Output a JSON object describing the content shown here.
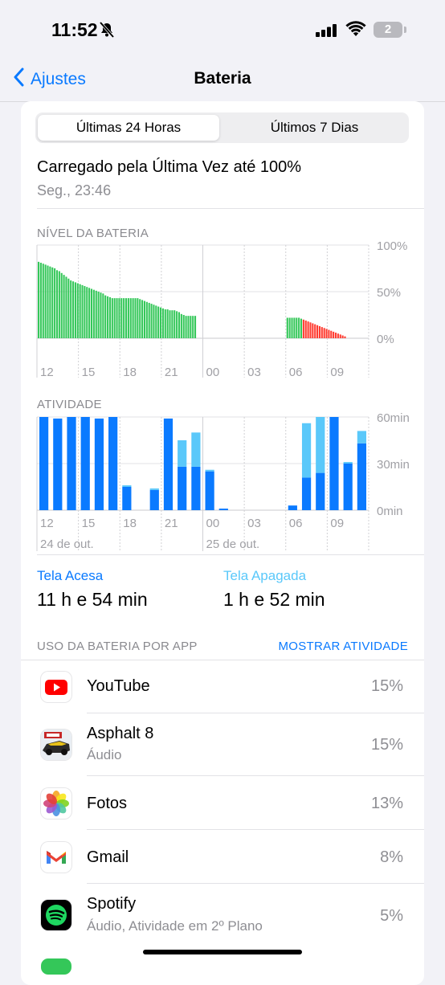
{
  "status_bar": {
    "time": "11:52",
    "battery": "2"
  },
  "nav": {
    "back_label": "Ajustes",
    "title": "Bateria"
  },
  "segments": [
    "Últimas 24 Horas",
    "Últimos 7 Dias"
  ],
  "last_charge": {
    "title": "Carregado pela Última Vez até 100%",
    "subtitle": "Seg., 23:46"
  },
  "chart_data": [
    {
      "type": "bar",
      "title": "NÍVEL DA BATERIA",
      "y_ticks": [
        "100%",
        "50%",
        "0%"
      ],
      "ylim": [
        0,
        100
      ],
      "x_ticks": [
        "12",
        "15",
        "18",
        "21",
        "00",
        "03",
        "06",
        "09"
      ],
      "colors": {
        "normal": "#34c759",
        "low": "#ff3b30"
      },
      "series": [
        {
          "hours_from_12": 0.0,
          "values": [
            82,
            81,
            80,
            79,
            78,
            77,
            76,
            75,
            73,
            72,
            70,
            68,
            66,
            64,
            62,
            61,
            60,
            59,
            58,
            57,
            56,
            55,
            54,
            53,
            52,
            51,
            50,
            49,
            48,
            46,
            45,
            44,
            43,
            43,
            43,
            43,
            43,
            43,
            43,
            43,
            43,
            43,
            43,
            43,
            42,
            41,
            40,
            39,
            38,
            37,
            36,
            35,
            34,
            33,
            32,
            31,
            31,
            30,
            30,
            30,
            29,
            28,
            26,
            25,
            24,
            24,
            24,
            24,
            24
          ]
        },
        {
          "hours_from_12": 18.0,
          "values": [
            22,
            22,
            22,
            22,
            22,
            22,
            21,
            20,
            19,
            18,
            17,
            16,
            15,
            14,
            13,
            12,
            11,
            10,
            9,
            8,
            7,
            6,
            5,
            4,
            3,
            2
          ]
        }
      ],
      "low_from_hour": 19.2
    },
    {
      "type": "bar",
      "title": "ATIVIDADE",
      "y_ticks": [
        "60min",
        "30min",
        "0min"
      ],
      "ylim": [
        0,
        60
      ],
      "x_ticks": [
        "12",
        "15",
        "18",
        "21",
        "00",
        "03",
        "06",
        "09"
      ],
      "date_labels": [
        "24 de out.",
        "25 de out."
      ],
      "colors": {
        "screen_on": "#0a7aff",
        "screen_off": "#5ac8fa"
      },
      "hours": [
        12,
        13,
        14,
        15,
        16,
        17,
        18,
        19,
        20,
        21,
        22,
        23,
        0,
        1,
        2,
        3,
        4,
        5,
        6,
        7,
        8,
        9,
        10,
        11
      ],
      "screen_on": [
        60,
        59,
        60,
        60,
        59,
        60,
        15,
        0,
        13,
        59,
        28,
        28,
        25,
        1,
        0,
        0,
        0,
        0,
        3,
        21,
        24,
        60,
        30,
        43
      ],
      "screen_off": [
        0,
        0,
        0,
        0,
        0,
        0,
        1,
        0,
        1,
        0,
        17,
        22,
        1,
        0,
        0,
        0,
        0,
        0,
        0,
        35,
        36,
        0,
        1,
        8
      ]
    }
  ],
  "stats": {
    "on_label": "Tela Acesa",
    "on_value": "11 h e 54 min",
    "off_label": "Tela Apagada",
    "off_value": "1 h e 52 min"
  },
  "usage": {
    "header": "USO DA BATERIA POR APP",
    "action": "MOSTRAR ATIVIDADE"
  },
  "apps": [
    {
      "name": "YouTube",
      "sub": "",
      "pct": "15%",
      "icon": "youtube-icon"
    },
    {
      "name": "Asphalt 8",
      "sub": "Áudio",
      "pct": "15%",
      "icon": "asphalt-icon"
    },
    {
      "name": "Fotos",
      "sub": "",
      "pct": "13%",
      "icon": "photos-icon"
    },
    {
      "name": "Gmail",
      "sub": "",
      "pct": "8%",
      "icon": "gmail-icon"
    },
    {
      "name": "Spotify",
      "sub": "Áudio, Atividade em 2º Plano",
      "pct": "5%",
      "icon": "spotify-icon"
    }
  ]
}
